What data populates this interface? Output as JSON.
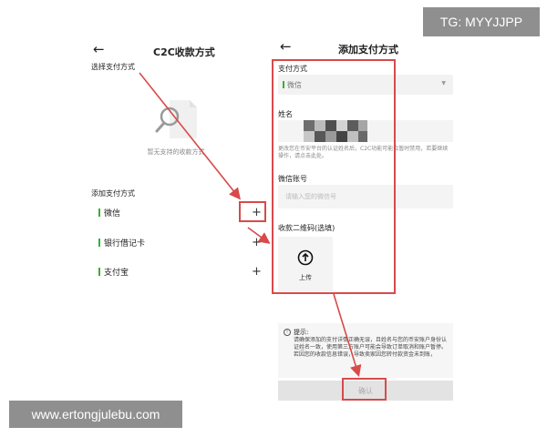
{
  "watermarks": {
    "top": "TG: MYYJJPP",
    "bottom": "www.ertongjulebu.com"
  },
  "left_screen": {
    "back_icon": "←",
    "title": "C2C收款方式",
    "subtitle": "选择支付方式",
    "empty_illustration": "magnifier-document-icon",
    "empty_text": "暂无支持的收款方式",
    "add_section_label": "添加支付方式",
    "methods": [
      {
        "label": "微信",
        "plus": "+"
      },
      {
        "label": "银行借记卡",
        "plus": "+"
      },
      {
        "label": "支付宝",
        "plus": "+"
      }
    ],
    "accent_color": "#32b332"
  },
  "right_screen": {
    "back_icon": "←",
    "title": "添加支付方式",
    "payment_method_label": "支付方式",
    "payment_method_value": "微信",
    "name_label": "姓名",
    "name_note": "更改您在币安平台的认证姓名后，C2C功能可能会暂时禁用，若要继续操作，请点击此处。",
    "account_label": "微信账号",
    "account_placeholder": "请输入您的微信号",
    "qr_label": "收款二维码(选填)",
    "upload_label": "上传",
    "tips_title": "提示:",
    "tips_body": "请确保添加的支付详情正确无误，且姓名与您的币安账户身份认证姓名一致，使用第三方账户可能会导致订单取消和账户暂停。若因您的收款信息错误，导致卖家因您转付款资金未到账，",
    "confirm_label": "确认"
  },
  "annotation_color": "#d94a4a"
}
